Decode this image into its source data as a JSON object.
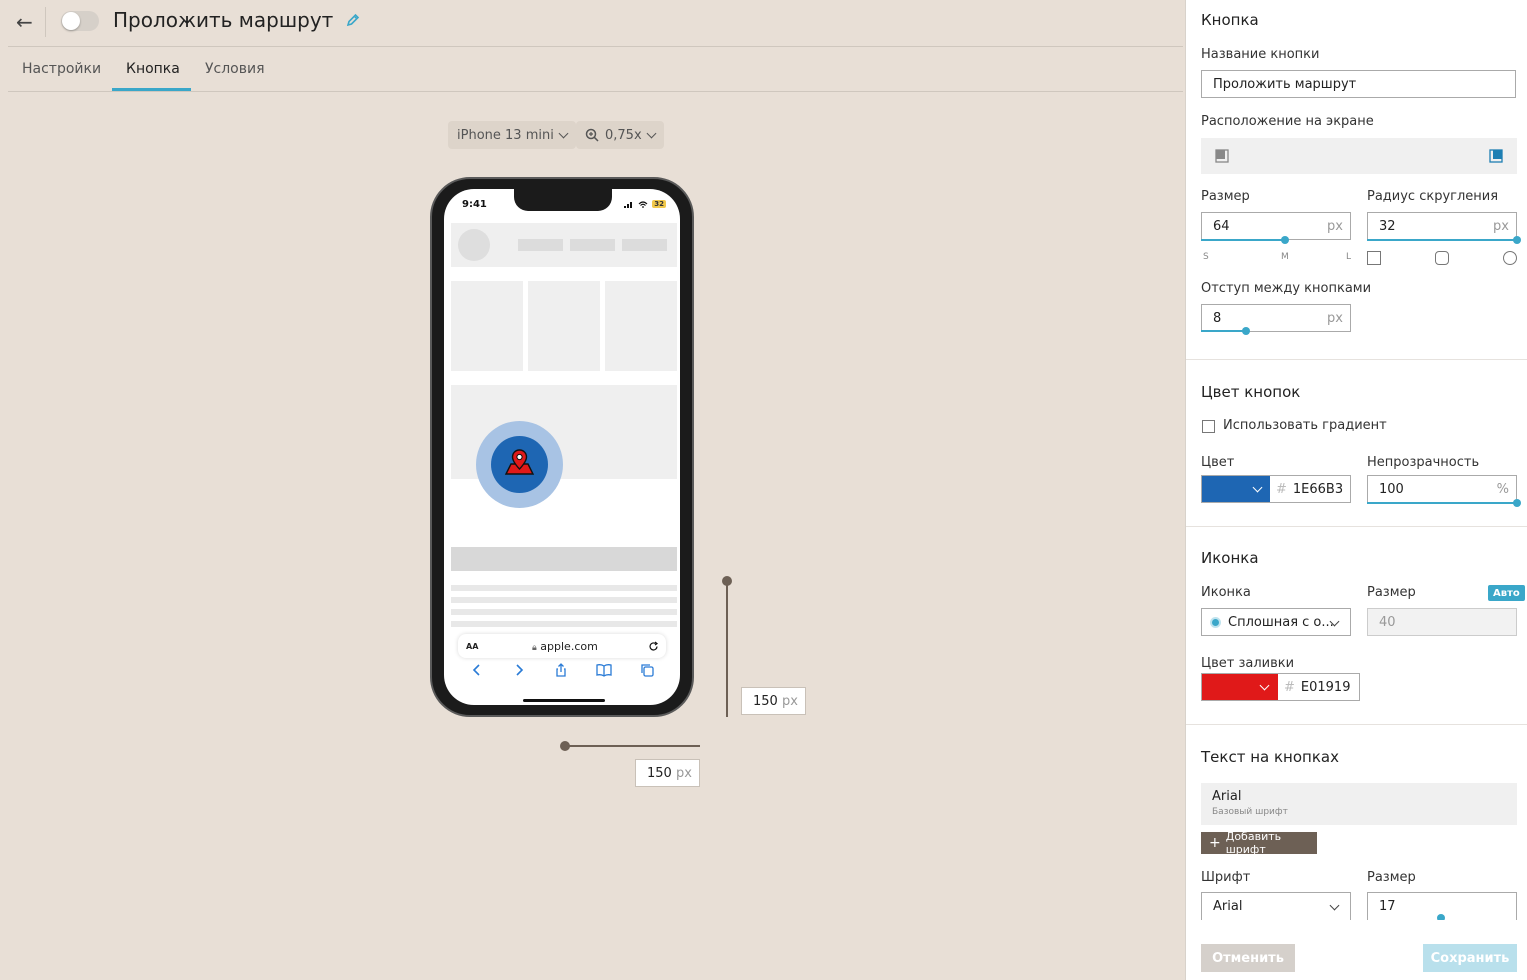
{
  "header": {
    "back_icon": "←",
    "title": "Проложить маршрут"
  },
  "tabs": [
    {
      "label": "Настройки"
    },
    {
      "label": "Кнопка"
    },
    {
      "label": "Условия"
    }
  ],
  "toolbar": {
    "device": "iPhone 13 mini",
    "zoom": "0,75x"
  },
  "phone": {
    "time": "9:41",
    "battery": "32",
    "font_btn": "AA",
    "url": "apple.com"
  },
  "canvas": {
    "height_value": "150",
    "width_value": "150",
    "unit": "px"
  },
  "panel": {
    "section_button": "Кнопка",
    "name_label": "Название кнопки",
    "name_value": "Проложить маршрут",
    "position_label": "Расположение на экране",
    "size_label": "Размер",
    "size_value": "64",
    "size_unit": "px",
    "size_marks": [
      "S",
      "M",
      "L"
    ],
    "radius_label": "Радиус скругления",
    "radius_value": "32",
    "radius_unit": "px",
    "spacing_label": "Отступ между кнопками",
    "spacing_value": "8",
    "spacing_unit": "px",
    "section_color": "Цвет кнопок",
    "gradient_label": "Использовать градиент",
    "color_label": "Цвет",
    "color_hex": "1E66B3",
    "color_swatch": "#1e66b3",
    "opacity_label": "Непрозрачность",
    "opacity_value": "100",
    "opacity_unit": "%",
    "section_icon": "Иконка",
    "icon_label": "Иконка",
    "icon_value": "Сплошная с о...",
    "icon_size_label": "Размер",
    "auto_badge": "Авто",
    "icon_size_value": "40",
    "fill_label": "Цвет заливки",
    "fill_hex": "E01919",
    "fill_swatch": "#e01919",
    "section_text": "Текст на кнопках",
    "font_name": "Arial",
    "font_sub": "Базовый шрифт",
    "add_font": "Добавить шрифт",
    "font_label": "Шрифт",
    "font_value": "Arial",
    "text_size_label": "Размер",
    "text_size_value": "17",
    "cancel": "Отменить",
    "save": "Сохранить"
  }
}
